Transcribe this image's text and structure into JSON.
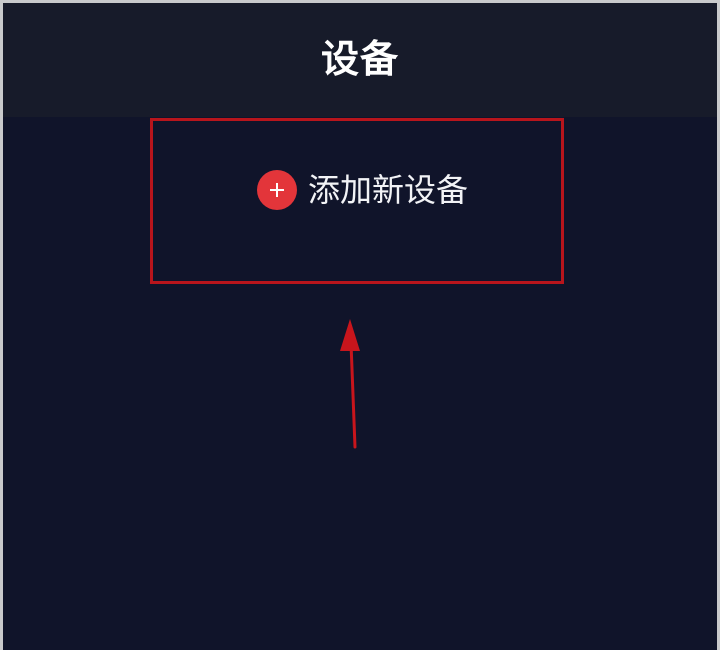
{
  "header": {
    "title": "设备"
  },
  "add_device": {
    "label": "添加新设备",
    "icon": "plus-circle-icon"
  },
  "annotation": {
    "color": "#c8151c"
  },
  "colors": {
    "background": "#10142a",
    "header_background": "#171b2a",
    "accent": "#e3353a"
  }
}
